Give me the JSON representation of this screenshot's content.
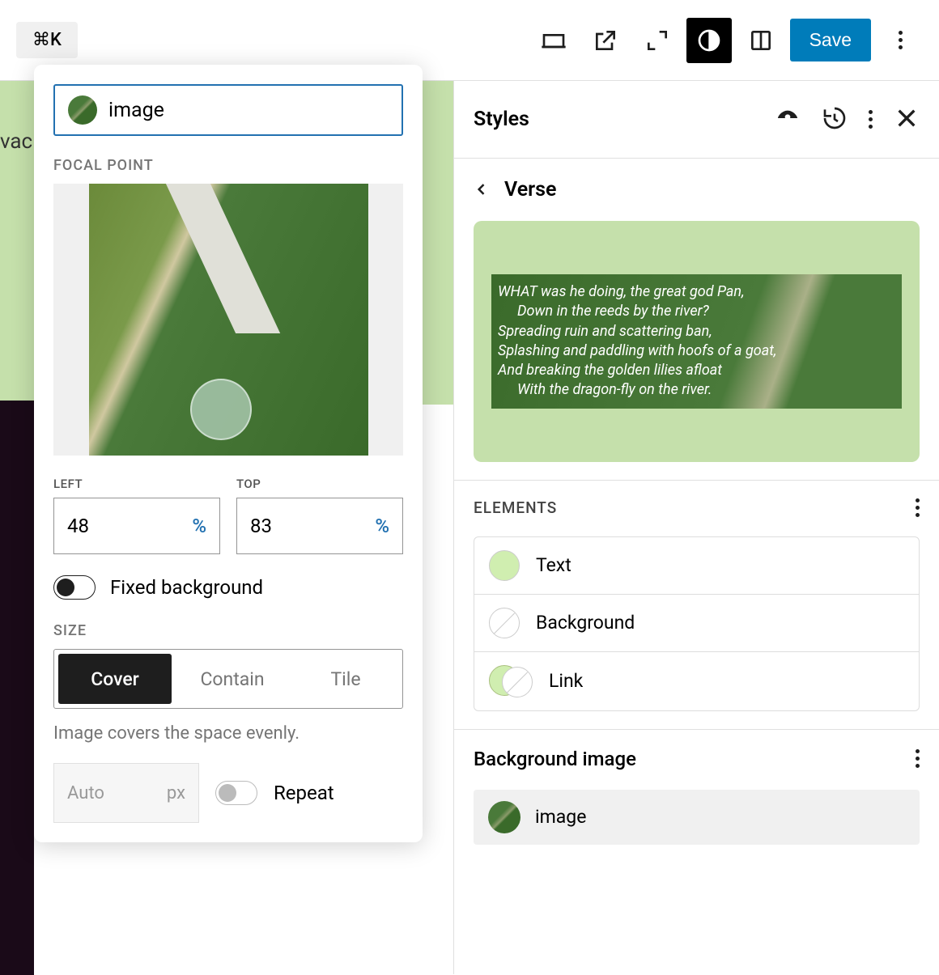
{
  "toolbar": {
    "shortcut": "⌘K",
    "save_label": "Save"
  },
  "popover": {
    "image_name": "image",
    "focal_point_label": "FOCAL POINT",
    "left_label": "LEFT",
    "top_label": "TOP",
    "left_value": "48",
    "top_value": "83",
    "unit": "%",
    "fixed_bg_label": "Fixed background",
    "fixed_bg": false,
    "size_label": "SIZE",
    "size_options": [
      "Cover",
      "Contain",
      "Tile"
    ],
    "size_selected": "Cover",
    "size_help": "Image covers the space evenly.",
    "auto_label": "Auto",
    "auto_unit": "px",
    "repeat_label": "Repeat",
    "repeat": false
  },
  "sidebar": {
    "title": "Styles",
    "block_name": "Verse",
    "verse_lines": [
      "WHAT was he doing, the great god Pan,",
      "Down in the reeds by the river?",
      "Spreading ruin and scattering ban,",
      "Splashing and paddling with hoofs of a goat,",
      "And breaking the golden lilies afloat",
      "With the dragon-fly on the river."
    ],
    "elements_label": "ELEMENTS",
    "elements": [
      {
        "label": "Text"
      },
      {
        "label": "Background"
      },
      {
        "label": "Link"
      }
    ],
    "bg_image_label": "Background image",
    "bg_image_name": "image"
  },
  "canvas": {
    "partial_text": "vac"
  }
}
